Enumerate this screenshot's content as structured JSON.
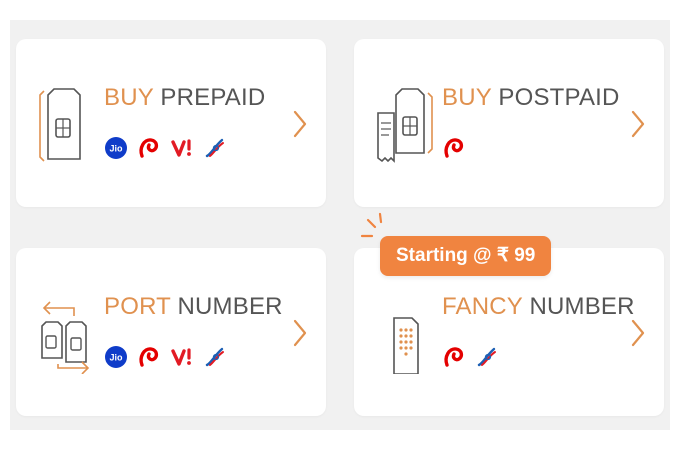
{
  "cards": {
    "prepaid": {
      "accent": "BUY",
      "rest": " PREPAID"
    },
    "postpaid": {
      "accent": "BUY",
      "rest": " POSTPAID"
    },
    "port": {
      "accent": "PORT",
      "rest": " NUMBER"
    },
    "fancy": {
      "accent": "FANCY",
      "rest": " NUMBER"
    }
  },
  "operators": {
    "jio": "Jio",
    "airtel": "airtel",
    "vi": "Vi",
    "bsnl": "bsnl"
  },
  "badge": {
    "text": "Starting @ ₹ 99"
  },
  "icons": {
    "prepaid": "sim-card-icon",
    "postpaid": "sim-with-bill-icon",
    "port": "sim-swap-icon",
    "fancy": "sim-keypad-icon",
    "chevron": "chevron-right-icon"
  },
  "colors": {
    "accent": "#e0914f",
    "badge": "#f08440",
    "jio": "#0f3cc9",
    "airtel": "#e40000",
    "vi": "#e21b24",
    "bsnl": "#1c5fb4"
  }
}
